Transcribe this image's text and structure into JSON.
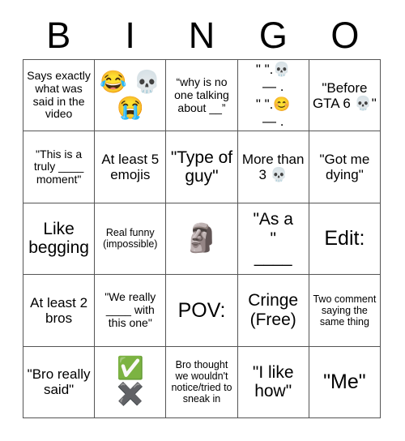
{
  "header": {
    "letters": [
      {
        "label": "B"
      },
      {
        "label": "I"
      },
      {
        "label": "N"
      },
      {
        "label": "G"
      },
      {
        "label": "O"
      }
    ]
  },
  "colors": {
    "background": "#ffffff",
    "text": "#000000",
    "grid_line": "#555555"
  },
  "grid": {
    "rows": 5,
    "columns": 5,
    "cells": [
      {
        "id": "b1",
        "text": "Says exactly what was said in the video",
        "size": "fs-sm"
      },
      {
        "id": "i1",
        "text": "😂 💀\n😭",
        "size": "fs-emoji"
      },
      {
        "id": "n1",
        "text": "“why is no one talking about __”",
        "size": "fs-sm"
      },
      {
        "id": "g1",
        "text": "\" \".💀\n— .\n\" \".😊\n— .",
        "size": "fs-mono"
      },
      {
        "id": "o1",
        "text": "\"Before GTA 6 💀\"",
        "size": "fs-md"
      },
      {
        "id": "b2",
        "text": "\"This is a truly ____ moment\"",
        "size": "fs-sm"
      },
      {
        "id": "i2",
        "text": "At least 5 emojis",
        "size": "fs-md"
      },
      {
        "id": "n2",
        "text": "\"Type of guy\"",
        "size": "fs-lg"
      },
      {
        "id": "g2",
        "text": "More than 3 💀",
        "size": "fs-md"
      },
      {
        "id": "o2",
        "text": "\"Got me dying\"",
        "size": "fs-md"
      },
      {
        "id": "b3",
        "text": "Like begging",
        "size": "fs-lg"
      },
      {
        "id": "i3",
        "text": "Real funny (impossible)",
        "size": "fs-xs"
      },
      {
        "id": "n3",
        "text": "🗿",
        "size": "fs-emoji-lg"
      },
      {
        "id": "g3",
        "text": "\"As a\n\"\n____",
        "size": "fs-lg"
      },
      {
        "id": "o3",
        "text": "Edit:",
        "size": "fs-xl"
      },
      {
        "id": "b4",
        "text": "At least 2 bros",
        "size": "fs-md"
      },
      {
        "id": "i4",
        "text": "\"We really ____ with this one\"",
        "size": "fs-sm"
      },
      {
        "id": "n4",
        "text": "POV:",
        "size": "fs-xl"
      },
      {
        "id": "g4",
        "text": "Cringe (Free)",
        "size": "fs-lg"
      },
      {
        "id": "o4",
        "text": "Two comment saying the same thing",
        "size": "fs-xs"
      },
      {
        "id": "b5",
        "text": "\"Bro really said\"",
        "size": "fs-md"
      },
      {
        "id": "i5",
        "text": "✅\n✖️",
        "size": "fs-emoji"
      },
      {
        "id": "n5",
        "text": "Bro thought we wouldn't notice/tried to sneak in",
        "size": "fs-xs"
      },
      {
        "id": "g5",
        "text": "\"I like how\"",
        "size": "fs-lg"
      },
      {
        "id": "o5",
        "text": "\"Me\"",
        "size": "fs-xl"
      }
    ]
  }
}
